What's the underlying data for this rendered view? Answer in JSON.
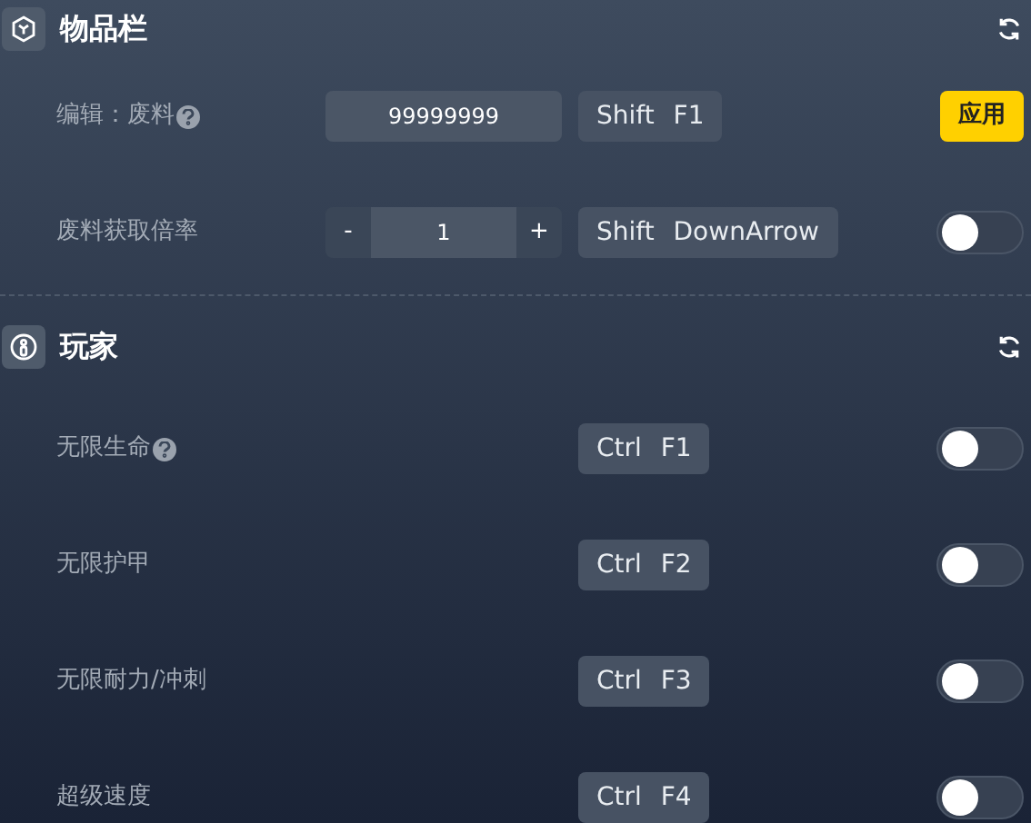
{
  "sections": [
    {
      "title": "物品栏",
      "kind": "box",
      "items": [
        {
          "kind": "input",
          "label": "编辑：废料",
          "help": true,
          "value": "99999999",
          "hotkey": "Shift F1",
          "action": "应用"
        },
        {
          "kind": "stepper",
          "label": "废料获取倍率",
          "help": false,
          "minus": "-",
          "value": "1",
          "plus": "+",
          "hotkey": "Shift DownArrow",
          "on": false
        }
      ]
    },
    {
      "title": "玩家",
      "kind": "person",
      "items": [
        {
          "kind": "toggle",
          "label": "无限生命",
          "help": true,
          "hotkey": "Ctrl F1",
          "on": false
        },
        {
          "kind": "toggle",
          "label": "无限护甲",
          "help": false,
          "hotkey": "Ctrl F2",
          "on": false
        },
        {
          "kind": "toggle",
          "label": "无限耐力/冲刺",
          "help": false,
          "hotkey": "Ctrl F3",
          "on": false
        },
        {
          "kind": "toggle",
          "label": "超级速度",
          "help": false,
          "hotkey": "Ctrl F4",
          "on": false
        }
      ]
    }
  ]
}
